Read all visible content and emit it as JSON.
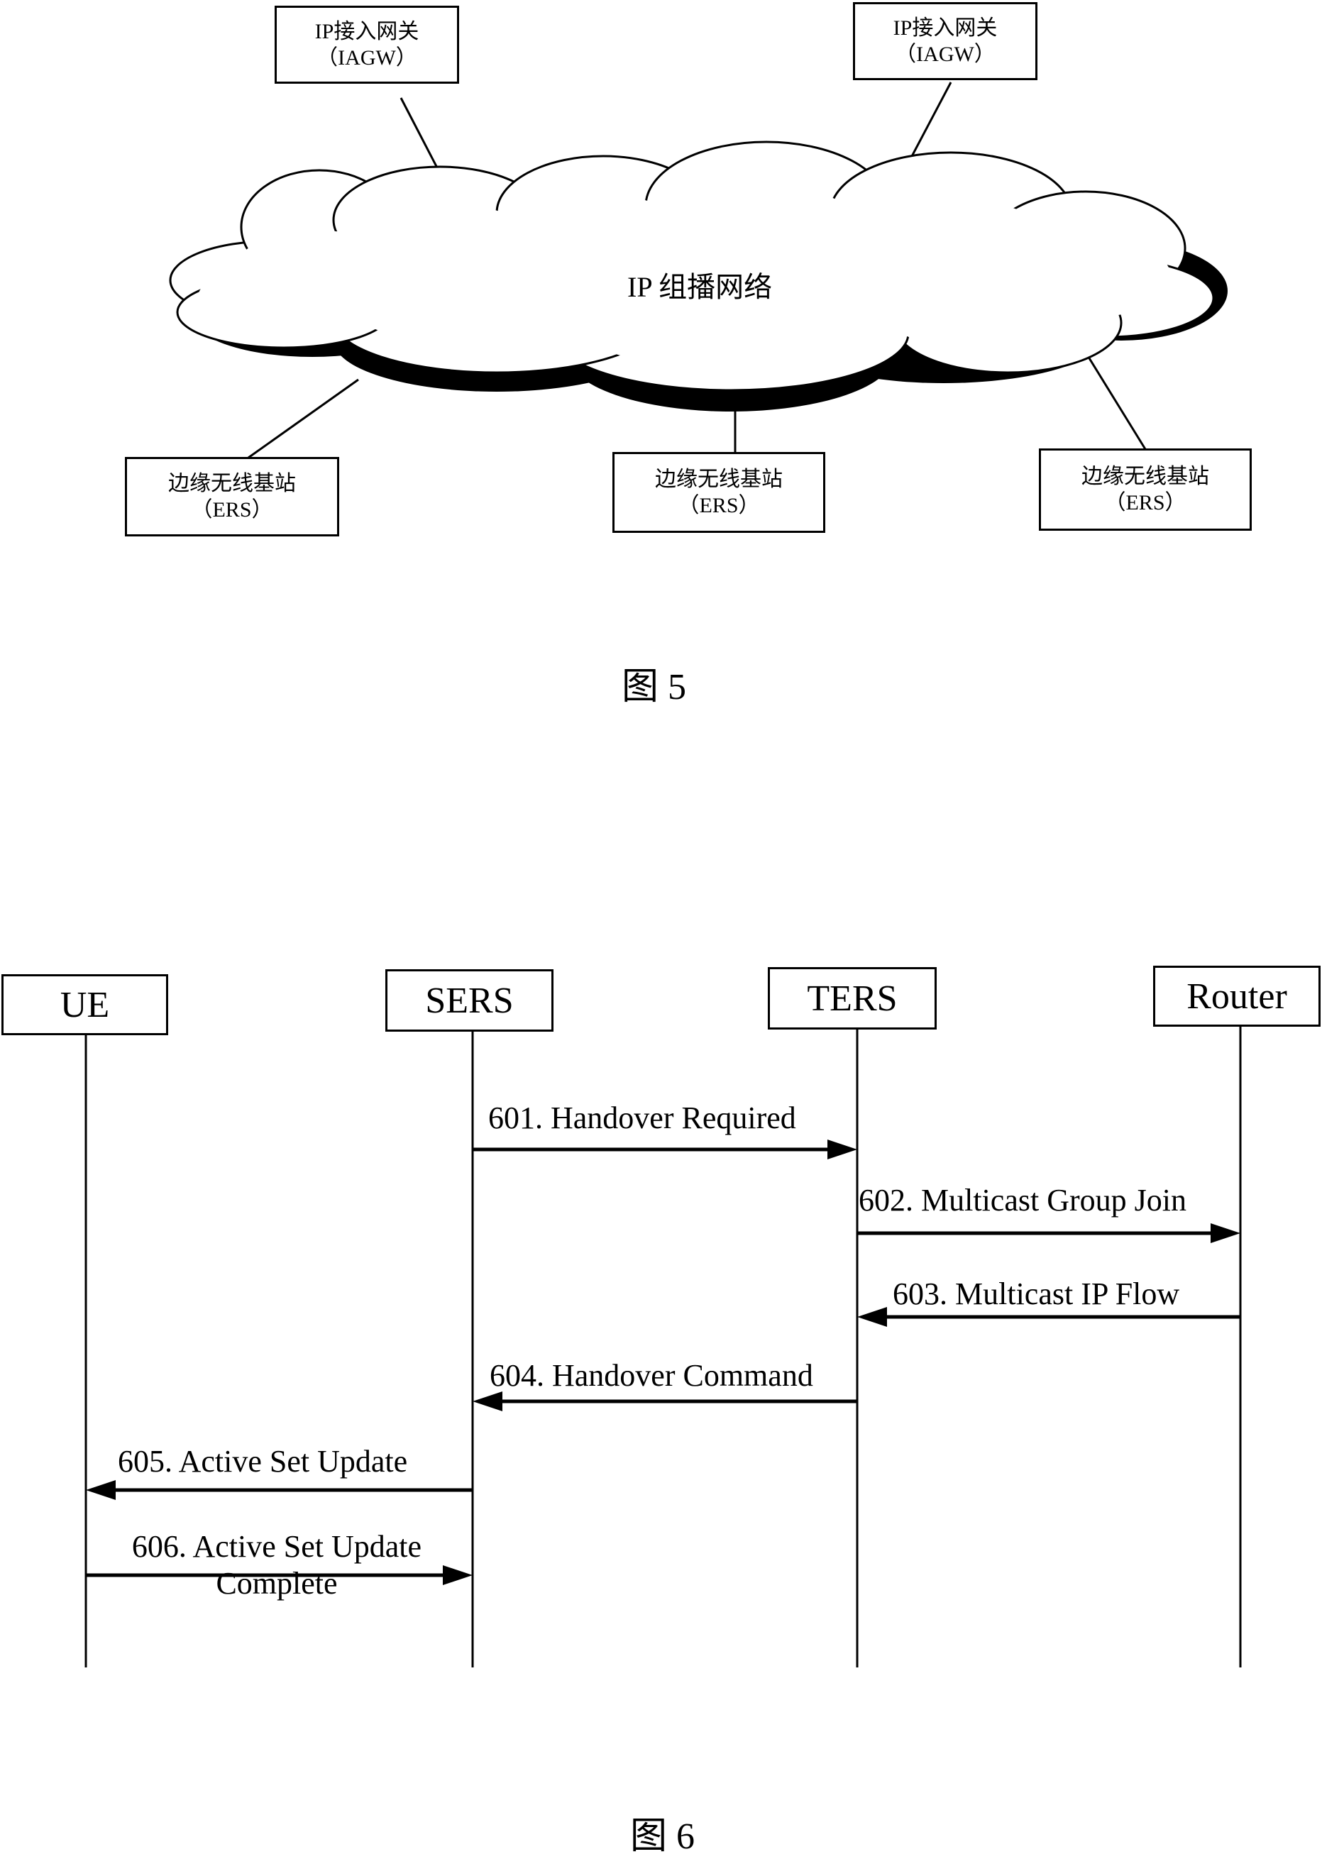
{
  "figure5": {
    "caption": "图 5",
    "cloud_label": "IP 组播网络",
    "gateways": [
      {
        "line1": "IP接入网关",
        "line2": "（IAGW）"
      },
      {
        "line1": "IP接入网关",
        "line2": "（IAGW）"
      }
    ],
    "base_stations": [
      {
        "line1": "边缘无线基站",
        "line2": "（ERS）"
      },
      {
        "line1": "边缘无线基站",
        "line2": "（ERS）"
      },
      {
        "line1": "边缘无线基站",
        "line2": "（ERS）"
      }
    ]
  },
  "figure6": {
    "caption": "图 6",
    "actors": [
      "UE",
      "SERS",
      "TERS",
      "Router"
    ],
    "messages": [
      {
        "id": "601",
        "label": "601. Handover Required",
        "from": "SERS",
        "to": "TERS"
      },
      {
        "id": "602",
        "label": "602. Multicast Group Join",
        "from": "TERS",
        "to": "Router"
      },
      {
        "id": "603",
        "label": "603. Multicast IP Flow",
        "from": "Router",
        "to": "TERS"
      },
      {
        "id": "604",
        "label": "604. Handover Command",
        "from": "TERS",
        "to": "SERS"
      },
      {
        "id": "605",
        "label": "605. Active Set Update",
        "from": "SERS",
        "to": "UE"
      },
      {
        "id": "606",
        "label": "606. Active Set Update",
        "label2": "Complete",
        "from": "UE",
        "to": "SERS"
      }
    ]
  }
}
